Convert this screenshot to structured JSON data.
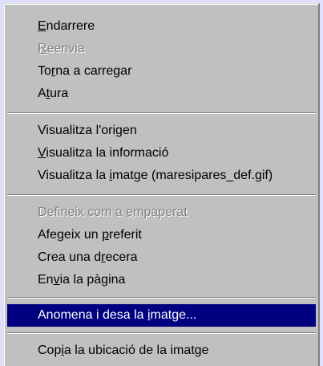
{
  "menu": {
    "groups": [
      {
        "items": [
          {
            "before": "",
            "key": "E",
            "after": "ndarrere",
            "enabled": true
          },
          {
            "before": "",
            "key": "R",
            "after": "eenvia",
            "enabled": false
          },
          {
            "before": "To",
            "key": "r",
            "after": "na a carregar",
            "enabled": true
          },
          {
            "before": "A",
            "key": "t",
            "after": "ura",
            "enabled": true
          }
        ]
      },
      {
        "items": [
          {
            "before": "Visualitza l'ori",
            "key": "g",
            "after": "en",
            "enabled": true
          },
          {
            "before": "",
            "key": "V",
            "after": "isualitza la informació",
            "enabled": true
          },
          {
            "before": "Visualitza la ",
            "key": "i",
            "after": "matge (maresipares_def.gif)",
            "enabled": true
          }
        ]
      },
      {
        "items": [
          {
            "before": "Defineix com a ",
            "key": "e",
            "after": "mpaperat",
            "enabled": false
          },
          {
            "before": "Afegeix un ",
            "key": "p",
            "after": "referit",
            "enabled": true
          },
          {
            "before": "Crea una d",
            "key": "r",
            "after": "ecera",
            "enabled": true
          },
          {
            "before": "En",
            "key": "v",
            "after": "ia la pàgina",
            "enabled": true
          }
        ]
      },
      {
        "items": [
          {
            "before": "Anomena i desa la ",
            "key": "i",
            "after": "matge...",
            "enabled": true,
            "selected": true
          }
        ]
      },
      {
        "items": [
          {
            "before": "Cop",
            "key": "i",
            "after": "a la ubicació de la imatge",
            "enabled": true
          }
        ]
      }
    ]
  },
  "colors": {
    "menu_background": "#c0c0c0",
    "highlight": "#000080",
    "highlight_text": "#ffffff",
    "disabled_text": "#808080",
    "desktop": "#dfdfff"
  }
}
